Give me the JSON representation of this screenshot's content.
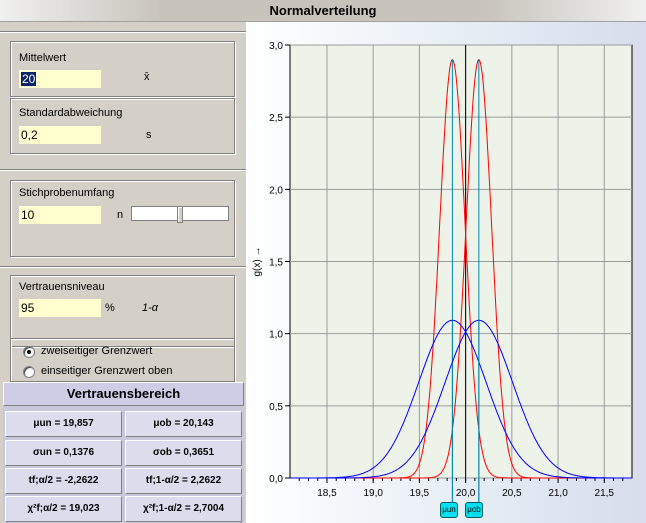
{
  "window": {
    "title": "Normalverteilung"
  },
  "mean": {
    "label": "Mittelwert",
    "value": "20",
    "symbol": "x̄"
  },
  "sd": {
    "label": "Standardabweichung",
    "value": "0,2",
    "symbol": "s"
  },
  "sample": {
    "label": "Stichprobenumfang",
    "value": "10",
    "symbol": "n",
    "slider_fraction": 0.5
  },
  "confidence": {
    "label": "Vertrauensniveau",
    "value": "95",
    "unit": "%",
    "symbol": "1-α"
  },
  "mode": {
    "options": [
      "zweiseitiger Grenzwert",
      "einseitiger Grenzwert oben"
    ],
    "selected": 0
  },
  "results": {
    "title": "Vertrauensbereich",
    "mu_un": "μun = 19,857",
    "mu_ob": "μob = 20,143",
    "sigma_un": "σun = 0,1376",
    "sigma_ob": "σob = 0,3651",
    "t_left": "tf;α/2 = -2,2622",
    "t_right": "tf;1-α/2 = 2,2622",
    "chi_left": "χ²f;α/2 = 19,023",
    "chi_right": "χ²f;1-α/2 = 2,7004"
  },
  "chart_data": {
    "type": "line",
    "ylabel": "g(x) →",
    "xlim": [
      18.1,
      21.8
    ],
    "ylim": [
      0,
      3.0
    ],
    "xticks": [
      "18,5",
      "19,0",
      "19,5",
      "20,0",
      "20,5",
      "21,0",
      "21,5"
    ],
    "xtick_values": [
      18.5,
      19.0,
      19.5,
      20.0,
      20.5,
      21.0,
      21.5
    ],
    "yticks": [
      "0,0",
      "0,5",
      "1,0",
      "1,5",
      "2,0",
      "2,5",
      "3,0"
    ],
    "ytick_values": [
      0,
      0.5,
      1.0,
      1.5,
      2.0,
      2.5,
      3.0
    ],
    "grid": true,
    "series": [
      {
        "mean": 19.857,
        "sd": 0.1376,
        "color": "#ff0000"
      },
      {
        "mean": 20.143,
        "sd": 0.1376,
        "color": "#ff0000"
      },
      {
        "mean": 19.857,
        "sd": 0.3651,
        "color": "#0000ff"
      },
      {
        "mean": 20.143,
        "sd": 0.3651,
        "color": "#0000ff"
      }
    ],
    "mean_line": 20.0,
    "markers": [
      "μun",
      "μob"
    ]
  }
}
